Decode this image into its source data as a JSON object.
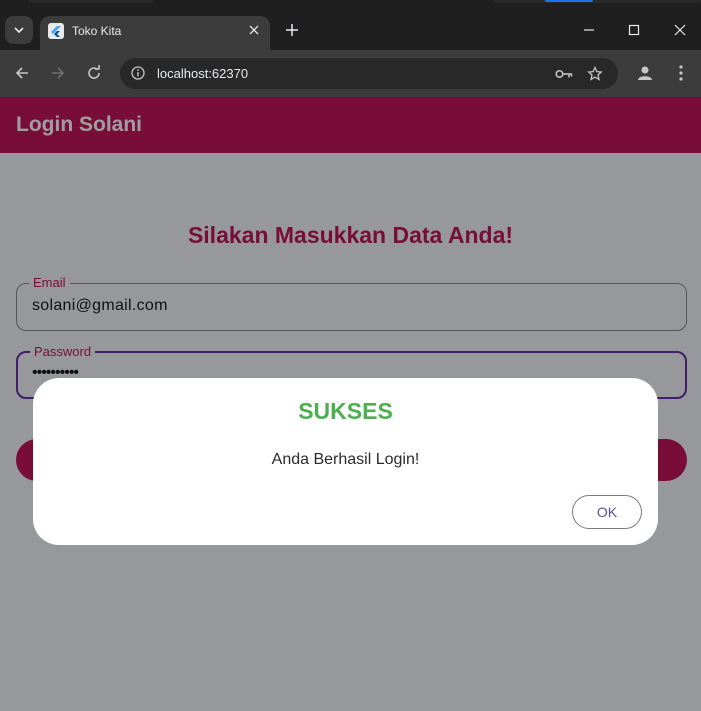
{
  "browser": {
    "tab_title": "Toko Kita",
    "url": "localhost:62370",
    "icons": [
      "tab-search-icon",
      "flutter-favicon-icon",
      "close-icon",
      "plus-icon",
      "minimize-icon",
      "maximize-icon",
      "close-window-icon",
      "back-icon",
      "forward-icon",
      "reload-icon",
      "info-icon",
      "key-icon",
      "star-icon",
      "profile-icon",
      "kebab-menu-icon"
    ]
  },
  "app": {
    "appbar_title": "Login Solani",
    "heading": "Silakan Masukkan Data Anda!",
    "email": {
      "label": "Email",
      "value": "solani@gmail.com"
    },
    "password": {
      "label": "Password",
      "value": "••••••••••"
    }
  },
  "dialog": {
    "title": "SUKSES",
    "message": "Anda Berhasil Login!",
    "ok_label": "OK"
  },
  "colors": {
    "primary": "#c2185b",
    "success": "#4caf50",
    "focus": "#6a32a8"
  }
}
